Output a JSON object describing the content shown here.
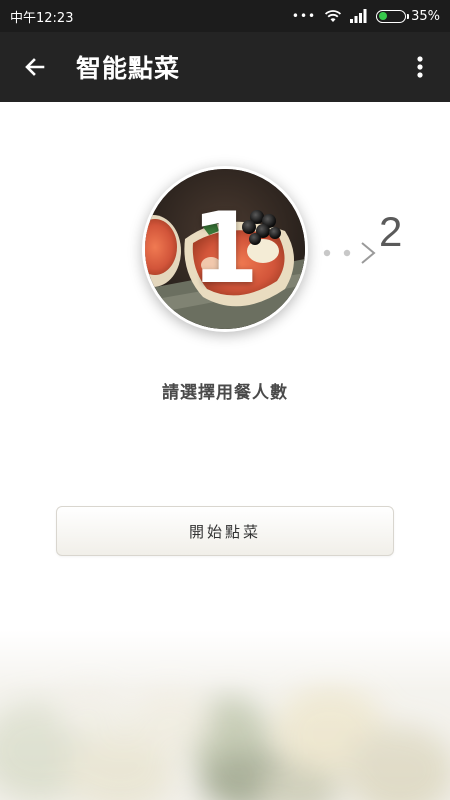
{
  "status_bar": {
    "time": "中午12:23",
    "notifications": "•••",
    "battery": "35%",
    "battery_level": 0.35
  },
  "app_bar": {
    "title": "智能點菜",
    "back_icon": "back-arrow-icon",
    "menu_icon": "more-vert-icon"
  },
  "steps": {
    "current": "1",
    "next": "2"
  },
  "main": {
    "prompt": "請選擇用餐人數",
    "start_button_label": "開始點菜"
  },
  "colors": {
    "app_bar": "#242424",
    "status_bar": "#1c1c1c",
    "battery_fill": "#37c84b",
    "prompt_text": "#4a4a4a"
  }
}
